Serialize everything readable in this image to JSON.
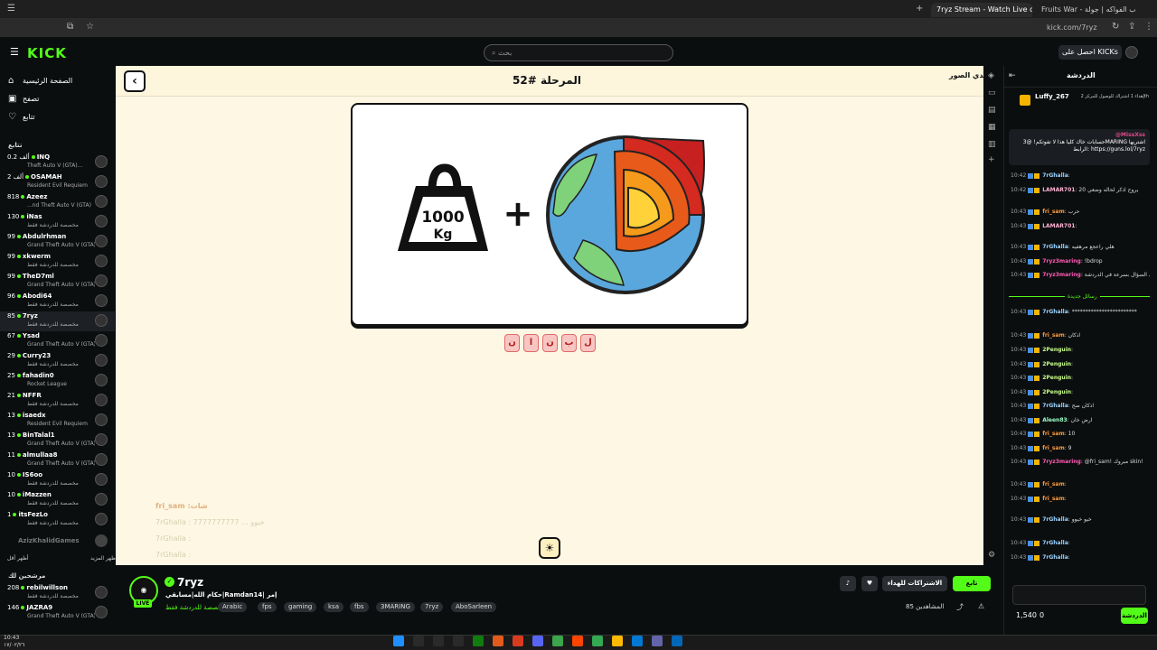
{
  "browser": {
    "tabs": [
      {
        "title": "7ryz Stream - Watch Live o",
        "active": true
      },
      {
        "title": "Fruits War - حرب الفواكه | جولة",
        "active": false
      },
      {
        "title": "",
        "active": false
      }
    ],
    "url": "kick.com/7ryz"
  },
  "header": {
    "logo": "KICK",
    "search_placeholder": "بحث",
    "kicks_button": "احصل على KICKs"
  },
  "sidebar": {
    "nav": [
      {
        "label": "الصفحة الرئيسية",
        "icon": "home-icon"
      },
      {
        "label": "تصفح",
        "icon": "browse-icon"
      },
      {
        "label": "تتابع",
        "icon": "heart-icon"
      }
    ],
    "following_title": "تتابع",
    "following": [
      {
        "count": "0.2 ألف",
        "name": "INQ",
        "category": "Theft Auto V (GTA)..."
      },
      {
        "count": "2 ألف",
        "name": "OSAMAH",
        "category": "Resident Evil Requiem"
      },
      {
        "count": "818",
        "name": "Azeez",
        "category": "...nd Theft Auto V (GTA)"
      },
      {
        "count": "130",
        "name": "iNas",
        "category": "مخصصة للدردشة فقط"
      },
      {
        "count": "99",
        "name": "Abdulrhman",
        "category": "Grand Theft Auto V (GTA)"
      },
      {
        "count": "99",
        "name": "xkwerm",
        "category": "مخصصة للدردشة فقط"
      },
      {
        "count": "99",
        "name": "TheD7ml",
        "category": "Grand Theft Auto V (GTA)"
      },
      {
        "count": "96",
        "name": "Abodi64",
        "category": "مخصصة للدردشة فقط"
      },
      {
        "count": "85",
        "name": "7ryz",
        "category": "مخصصة للدردشة فقط"
      },
      {
        "count": "67",
        "name": "Ysad",
        "category": "Grand Theft Auto V (GTA)"
      },
      {
        "count": "29",
        "name": "Curry23",
        "category": "مخصصة للدردشة فقط"
      },
      {
        "count": "25",
        "name": "fahadin0",
        "category": "Rocket League"
      },
      {
        "count": "21",
        "name": "NFFR",
        "category": "مخصصة للدردشة فقط"
      },
      {
        "count": "13",
        "name": "isaedx",
        "category": "Resident Evil Requiem"
      },
      {
        "count": "13",
        "name": "BinTalal1",
        "category": "Grand Theft Auto V (GTA)"
      },
      {
        "count": "11",
        "name": "almullaa8",
        "category": "Grand Theft Auto V (GTA)"
      },
      {
        "count": "10",
        "name": "IS6oo",
        "category": "مخصصة للدردشة فقط"
      },
      {
        "count": "10",
        "name": "iMazzen",
        "category": "مخصصة للدردشة فقط"
      },
      {
        "count": "1",
        "name": "itsFezLo",
        "category": "مخصصة للدردشة فقط"
      }
    ],
    "offline_channel": "AzizKhalidGames",
    "show_more": "أظهر المزيد",
    "show_less": "أظهر أقل",
    "recommended_title": "مرشحين لك",
    "recommended": [
      {
        "count": "208",
        "name": "rebilwillson",
        "category": "مخصصة للدردشة فقط"
      },
      {
        "count": "146",
        "name": "JAZRA9",
        "category": "Grand Theft Auto V (GTA)"
      }
    ]
  },
  "game": {
    "level": "المرحلة #52",
    "back_icon": "chevron-left-icon",
    "logo_text": "تحدي الصور",
    "weight_label_1": "1000",
    "weight_label_2": "Kg",
    "plus": "+",
    "letters": [
      "ل",
      "ب",
      "ن",
      "ا",
      "ن"
    ],
    "hint_icon": "lightbulb-icon",
    "overlay_title": "fri_sam :شات",
    "overlay_lines": [
      "7rGhalla : 7777777777 ... خيوو",
      "7rGhalla :",
      "7rGhalla :"
    ]
  },
  "stream": {
    "streamer": "7ryz",
    "live": "LIVE",
    "title": "حكام الله|مسابقي|Ramdan14| إمر",
    "category": "مخصصة للدردشة فقط",
    "tags": [
      "Arabic",
      "fps",
      "gaming",
      "ksa",
      "fbs",
      "3MARING",
      "7ryz",
      "AboSarleen"
    ],
    "follow_label": "تابع",
    "gift_sub_label": "الاشتراكات للهداء",
    "viewers_label": "المشاهدين 85"
  },
  "chat": {
    "title": "الدردشة",
    "sub_goal_user": "Luffy_267",
    "sub_goal_text": "إهداء 1 اشتراك للوصول للمركز 2th",
    "pinned_user": "@MissXss",
    "pinned_text": "حسابات خاك كليا هذا لا تفوتكم! @3MARING اشتريها الرابط: https://guns.lol/7ryz",
    "new_messages_label": "رسائل جديدة",
    "messages": [
      {
        "time": "10:42",
        "user": "7rGhalla",
        "text": ""
      },
      {
        "time": "10:42",
        "user": "LAMAR701",
        "text": "يروح آذكر لحاله وضعي 20"
      },
      {
        "time": "10:43",
        "user": "fri_sam",
        "text": "حرب"
      },
      {
        "time": "10:43",
        "user": "LAMAR701",
        "text": ""
      },
      {
        "time": "10:43",
        "user": "7rGhalla",
        "text": "هلي راعجع مرهفيه"
      },
      {
        "time": "10:43",
        "user": "7ryz3maring",
        "text": "!bdrop"
      },
      {
        "time": "10:43",
        "user": "7ryz3maring",
        "text": "علي السؤال بسرعة في الدردشة"
      },
      {
        "time": "10:43",
        "user": "7rGhalla",
        "text": "************************"
      },
      {
        "time": "10:43",
        "user": "fri_sam",
        "text": "اذكان"
      },
      {
        "time": "10:43",
        "user": "2Penguin",
        "text": ""
      },
      {
        "time": "10:43",
        "user": "2Penguin",
        "text": ""
      },
      {
        "time": "10:43",
        "user": "2Penguin",
        "text": ""
      },
      {
        "time": "10:43",
        "user": "2Penguin",
        "text": ""
      },
      {
        "time": "10:43",
        "user": "7rGhalla",
        "text": "اذكان صح"
      },
      {
        "time": "10:43",
        "user": "Aleen83",
        "text": "ارض خان"
      },
      {
        "time": "10:43",
        "user": "fri_sam",
        "text": "10"
      },
      {
        "time": "10:43",
        "user": "fri_sam",
        "text": "9"
      },
      {
        "time": "10:43",
        "user": "7ryz3maring",
        "text": "@fri_sam! مبروك skin!"
      },
      {
        "time": "10:43",
        "user": "fri_sam",
        "text": ""
      },
      {
        "time": "10:43",
        "user": "fri_sam",
        "text": ""
      },
      {
        "time": "10:43",
        "user": "7rGhalla",
        "text": "خيو خيوو"
      },
      {
        "time": "10:43",
        "user": "7rGhalla",
        "text": ""
      },
      {
        "time": "10:43",
        "user": "7rGhalla",
        "text": ""
      }
    ],
    "send_label": "الدردشة",
    "points": "1,540",
    "emote_count": "0"
  },
  "taskbar": {
    "time": "10:43",
    "date": "١٧/٠٢/٢٦"
  },
  "colors": {
    "brand": "#53fc18",
    "stage_bg": "#fdf7e3",
    "letter_tile": "#f8c6c2"
  }
}
